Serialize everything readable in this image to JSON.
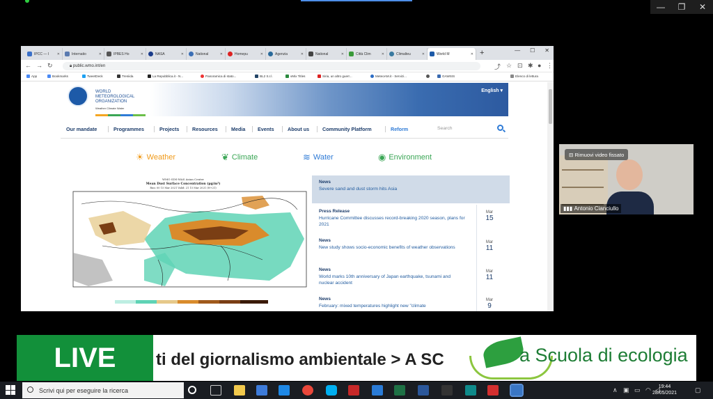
{
  "browser": {
    "tabs": [
      {
        "label": "IPCC — I"
      },
      {
        "label": "Internatio"
      },
      {
        "label": "IPBES Ho"
      },
      {
        "label": "NASA"
      },
      {
        "label": "National"
      },
      {
        "label": "Homepu"
      },
      {
        "label": "Agenzia"
      },
      {
        "label": "National"
      },
      {
        "label": "Città Clim"
      },
      {
        "label": "Climalteu"
      },
      {
        "label": "World M"
      }
    ],
    "new_tab": "+",
    "url": "public.wmo.int/en",
    "bookmarks": [
      "App",
      "Bookmarks",
      "TweetDeck",
      "Treniida",
      "La Repubblica.it - N...",
      "Panoramica di stato...",
      "BL2 S.r.l.",
      "vMix Titles",
      "Siria, un altro guerr...",
      "MeteoAM.it - Servizi...",
      "GAWSIS",
      "Elenco di lettura"
    ]
  },
  "wmo": {
    "org_name": [
      "WORLD",
      "METEOROLOGICAL",
      "ORGANIZATION"
    ],
    "tagline": "Weather  Climate  Water",
    "language": "English",
    "nav": [
      "Our mandate",
      "Programmes",
      "Projects",
      "Resources",
      "Media",
      "Events",
      "About us",
      "Community Platform",
      "Reform"
    ],
    "search_placeholder": "Search",
    "categories": [
      "Weather",
      "Climate",
      "Water",
      "Environment"
    ],
    "map": {
      "title1": "WMO SDS-WAS Asian Center",
      "title2": "Mean Dust Surface Concentration (μg/m³)",
      "title3": "Run: 00 15 Mar 2021     Valid: 21 15 Mar 2021 (H+21)"
    },
    "featured": {
      "kind": "News",
      "title": "Severe sand and dust storm hits Asia"
    },
    "items": [
      {
        "kind": "Press Release",
        "title": "Hurricane Committee discusses record-breaking 2020 season, plans for 2021",
        "month": "Mar",
        "day": "15"
      },
      {
        "kind": "News",
        "title": "New study shows socio-economic benefits of weather observations",
        "month": "Mar",
        "day": "11"
      },
      {
        "kind": "News",
        "title": "World marks 10th anniversary of Japan earthquake, tsunami and nuclear accident",
        "month": "Mar",
        "day": "11"
      },
      {
        "kind": "News",
        "title": "February: mixed temperatures highlight new \"climate",
        "month": "Mar",
        "day": "9"
      }
    ]
  },
  "video": {
    "pin_label": "Rimuovi video fissato",
    "name": "Antonio Cianciullo"
  },
  "ticker": {
    "live": "LIVE",
    "text": "ti del giornalismo ambientale > A SC",
    "brand": "a Scuola di ecologia"
  },
  "taskbar": {
    "search_placeholder": "Scrivi qui per eseguire la ricerca",
    "time": "19:44",
    "date": "28/05/2021"
  },
  "colors": {
    "accent": "#2f7bd6",
    "live_green": "#12903a",
    "brand_green": "#1e7d35"
  }
}
